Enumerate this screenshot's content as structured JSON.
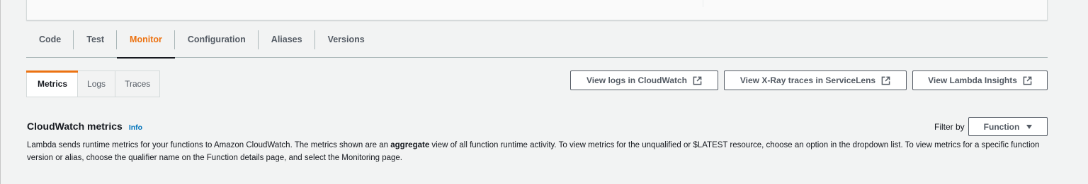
{
  "main_tabs": [
    {
      "label": "Code"
    },
    {
      "label": "Test"
    },
    {
      "label": "Monitor",
      "active": true
    },
    {
      "label": "Configuration"
    },
    {
      "label": "Aliases"
    },
    {
      "label": "Versions"
    }
  ],
  "sub_tabs": [
    {
      "label": "Metrics",
      "active": true
    },
    {
      "label": "Logs"
    },
    {
      "label": "Traces"
    }
  ],
  "actions": {
    "view_logs": "View logs in CloudWatch",
    "view_xray": "View X-Ray traces in ServiceLens",
    "view_insights": "View Lambda Insights"
  },
  "metrics_section": {
    "title": "CloudWatch metrics",
    "info_link": "Info",
    "filter_label": "Filter by",
    "filter_value": "Function",
    "description_part1": "Lambda sends runtime metrics for your functions to Amazon CloudWatch. The metrics shown are an ",
    "description_bold": "aggregate",
    "description_part2": " view of all function runtime activity. To view metrics for the unqualified or $LATEST resource, choose an option in the dropdown list. To view metrics for a specific function version or alias, choose the qualifier name on the Function details page, and select the Monitoring page."
  },
  "colors": {
    "accent": "#ec7211",
    "link": "#0073bb",
    "text": "#16191f",
    "muted": "#545b64",
    "background": "#f2f3f3"
  },
  "icons": {
    "external_link": "external-link-icon",
    "dropdown": "caret-down-icon"
  }
}
